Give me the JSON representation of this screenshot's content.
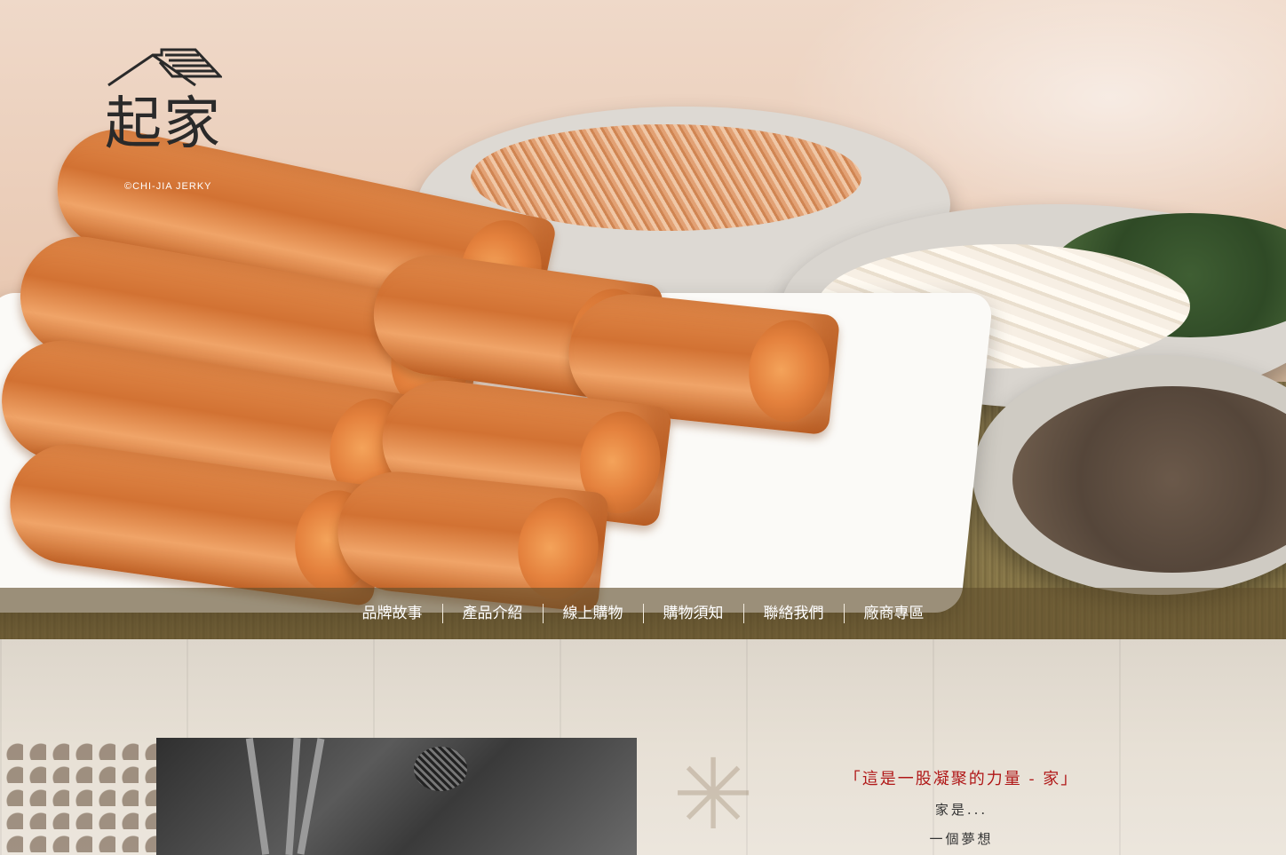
{
  "brand": {
    "logo_text": "起家",
    "logo_sub": "©CHI-JIA JERKY"
  },
  "nav": {
    "items": [
      "品牌故事",
      "產品介紹",
      "線上購物",
      "購物須知",
      "聯絡我們",
      "廠商專區"
    ]
  },
  "story": {
    "quote": "「這是一股凝聚的力量 - 家」",
    "line1": "家是...",
    "line2": "一個夢想"
  },
  "colors": {
    "nav_bg": "#5f4e2c",
    "quote_red": "#b01818"
  }
}
